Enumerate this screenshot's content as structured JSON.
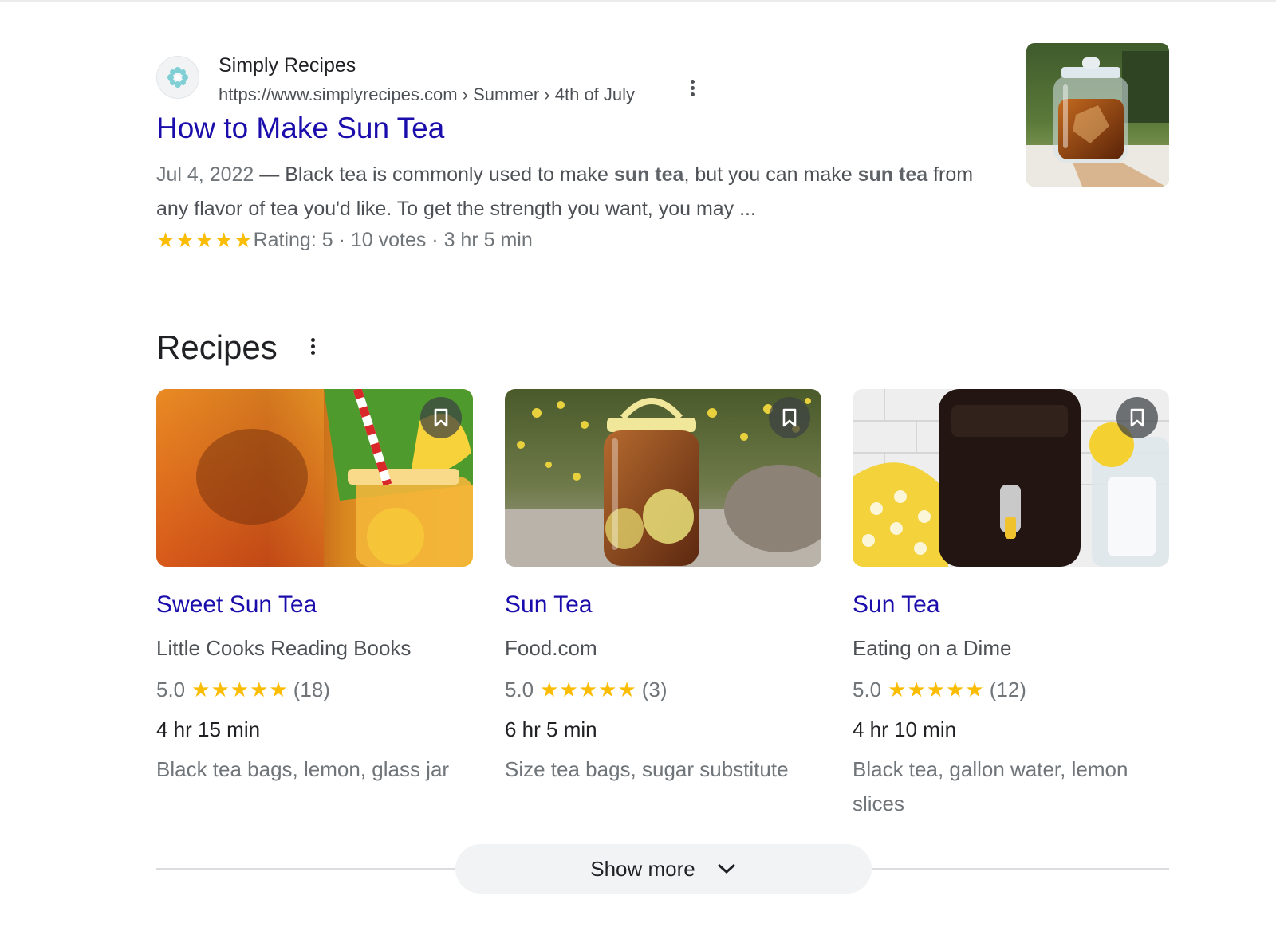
{
  "result": {
    "site_name": "Simply Recipes",
    "url": "https://www.simplyrecipes.com › Summer › 4th of July",
    "title": "How to Make Sun Tea",
    "snippet_date": "Jul 4, 2022",
    "snippet_dash": " — ",
    "snippet_parts": [
      "Black tea is commonly used to make ",
      "sun tea",
      ", but you can make ",
      "sun tea",
      " from any flavor of tea you'd like. To get the strength you want, you may ..."
    ],
    "rating_text": "Rating: 5 · 10 votes · 3 hr 5 min",
    "rating_stars": 5,
    "thumbnail_icon": "glass-jar-sun-tea-image"
  },
  "recipes": {
    "heading": "Recipes",
    "cards": [
      {
        "title": "Sweet Sun Tea",
        "source": "Little Cooks Reading Books",
        "rating": "5.0",
        "stars": 5,
        "count": "(18)",
        "time": "4 hr 15 min",
        "ingredients": "Black tea bags, lemon, glass jar",
        "image_icon": "iced-tea-jar-straw-image"
      },
      {
        "title": "Sun Tea",
        "source": "Food.com",
        "rating": "5.0",
        "stars": 5,
        "count": "(3)",
        "time": "6 hr 5 min",
        "ingredients": "Size tea bags, sugar substitute",
        "image_icon": "tea-jar-in-garden-image"
      },
      {
        "title": "Sun Tea",
        "source": "Eating on a Dime",
        "rating": "5.0",
        "stars": 5,
        "count": "(12)",
        "time": "4 hr 10 min",
        "ingredients": "Black tea, gallon water, lemon slices",
        "image_icon": "beverage-dispenser-image"
      }
    ]
  },
  "show_more": {
    "label": "Show more"
  },
  "colors": {
    "link": "#1a0dab",
    "star": "#fbbc04",
    "muted": "#70757a"
  }
}
